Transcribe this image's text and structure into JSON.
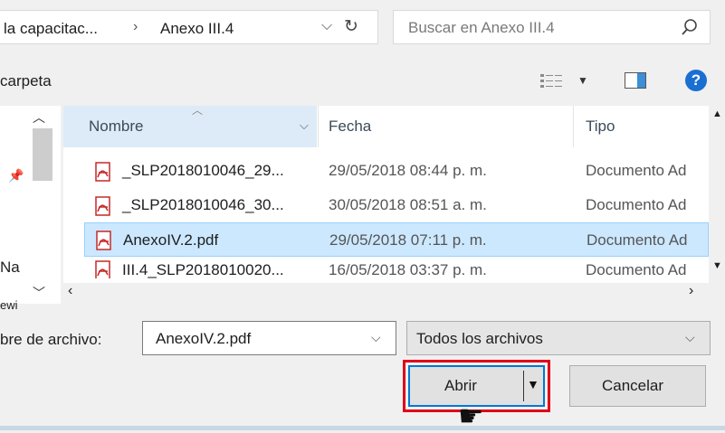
{
  "address": {
    "crumbs": [
      "la capacitac...",
      "Anexo III.4"
    ],
    "separator": "›",
    "dropdown_icon": "chevron-down-icon",
    "refresh_icon": "refresh-icon"
  },
  "search": {
    "placeholder": "Buscar en Anexo III.4",
    "icon": "search-icon"
  },
  "toolbar": {
    "new_folder_label": "carpeta",
    "help_label": "?"
  },
  "nav": {
    "item1": "Na",
    "item2": "ewi"
  },
  "columns": {
    "name": "Nombre",
    "date": "Fecha",
    "type": "Tipo"
  },
  "files": [
    {
      "name": "_SLP2018010046_29...",
      "date": "29/05/2018 08:44 p. m.",
      "type": "Documento Ad"
    },
    {
      "name": "_SLP2018010046_30...",
      "date": "30/05/2018 08:51 a. m.",
      "type": "Documento Ad"
    },
    {
      "name": "AnexoIV.2.pdf",
      "date": "29/05/2018 07:11 p. m.",
      "type": "Documento Ad"
    },
    {
      "name": "III.4_SLP2018010020...",
      "date": "16/05/2018 03:37 p. m.",
      "type": "Documento Ad"
    }
  ],
  "footer": {
    "filename_label": "bre de archivo:",
    "filename_value": "AnexoIV.2.pdf",
    "filetype_value": "Todos los archivos",
    "open_label": "Abrir",
    "cancel_label": "Cancelar"
  },
  "colors": {
    "accent": "#0078d7",
    "highlight": "#e0001a",
    "selection": "#cce8ff",
    "pdf_icon": "#c62828"
  }
}
